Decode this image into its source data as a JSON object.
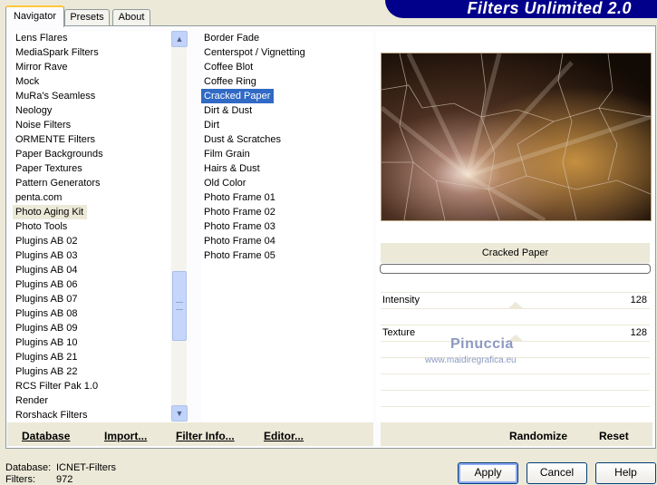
{
  "banner": {
    "title": "Filters Unlimited 2.0"
  },
  "tabs": [
    {
      "label": "Navigator"
    },
    {
      "label": "Presets"
    },
    {
      "label": "About"
    }
  ],
  "categories": [
    "Lens Flares",
    "MediaSpark Filters",
    "Mirror Rave",
    "Mock",
    "MuRa's Seamless",
    "Neology",
    "Noise Filters",
    "ORMENTE Filters",
    "Paper Backgrounds",
    "Paper Textures",
    "Pattern Generators",
    "penta.com",
    "Photo Aging Kit",
    "Photo Tools",
    "Plugins AB 02",
    "Plugins AB 03",
    "Plugins AB 04",
    "Plugins AB 06",
    "Plugins AB 07",
    "Plugins AB 08",
    "Plugins AB 09",
    "Plugins AB 10",
    "Plugins AB 21",
    "Plugins AB 22",
    "RCS Filter Pak 1.0",
    "Render",
    "Rorshack Filters"
  ],
  "selected_category": "Photo Aging Kit",
  "filters": [
    "Border Fade",
    "Centerspot / Vignetting",
    "Coffee Blot",
    "Coffee Ring",
    "Cracked Paper",
    "Dirt & Dust",
    "Dirt",
    "Dust & Scratches",
    "Film Grain",
    "Hairs & Dust",
    "Old Color",
    "Photo Frame 01",
    "Photo Frame 02",
    "Photo Frame 03",
    "Photo Frame 04",
    "Photo Frame 05"
  ],
  "selected_filter": "Cracked Paper",
  "toolbar": {
    "database": "Database",
    "import": "Import...",
    "filter_info": "Filter Info...",
    "editor": "Editor...",
    "randomize": "Randomize",
    "reset": "Reset"
  },
  "preview": {
    "filter_name": "Cracked Paper"
  },
  "params": [
    {
      "label": "Intensity",
      "value": "128"
    },
    {
      "label": "Texture",
      "value": "128"
    }
  ],
  "watermark": {
    "line1": "Pinuccia",
    "line2": "www.maidiregrafica.eu"
  },
  "status": {
    "database_label": "Database:",
    "database_value": "ICNET-Filters",
    "filters_label": "Filters:",
    "filters_value": "972"
  },
  "buttons": {
    "apply": "Apply",
    "cancel": "Cancel",
    "help": "Help"
  },
  "colors": {
    "banner": "#00008b",
    "selection": "#316ac5"
  }
}
